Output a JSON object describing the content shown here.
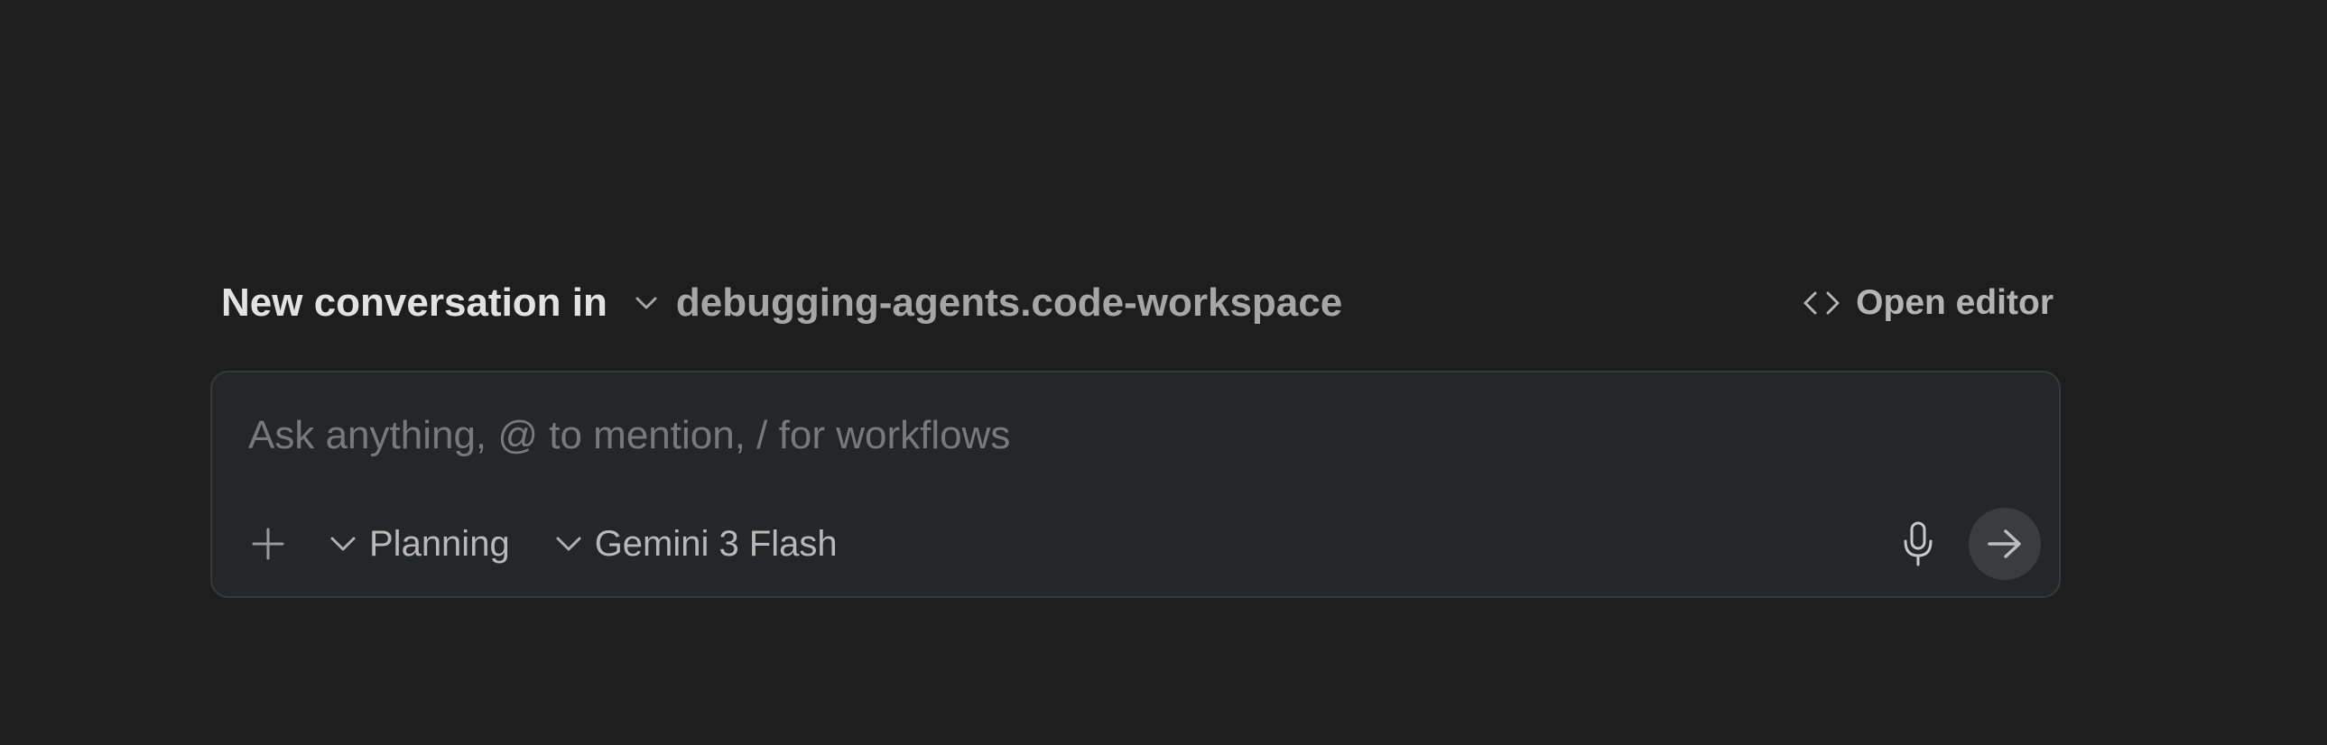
{
  "header": {
    "title": "New conversation in",
    "workspace": "debugging-agents.code-workspace",
    "workspace_icon": "chevron-down-icon",
    "open_editor_label": "Open editor",
    "open_editor_icon": "code-icon"
  },
  "composer": {
    "placeholder": "Ask anything, @ to mention, / for workflows",
    "value": "",
    "add_icon": "plus-icon",
    "mode": {
      "label": "Planning",
      "icon": "chevron-down-icon"
    },
    "model": {
      "label": "Gemini 3 Flash",
      "icon": "chevron-down-icon"
    },
    "mic_icon": "microphone-icon",
    "send_icon": "arrow-right-icon"
  },
  "colors": {
    "background": "#1e1e1e",
    "composer_background": "#242728",
    "composer_border": "#36393b",
    "title_text": "#e2e2e2",
    "secondary_text": "#a6a6a6",
    "placeholder_text": "#77797b",
    "send_button": "#3a3c3e"
  }
}
